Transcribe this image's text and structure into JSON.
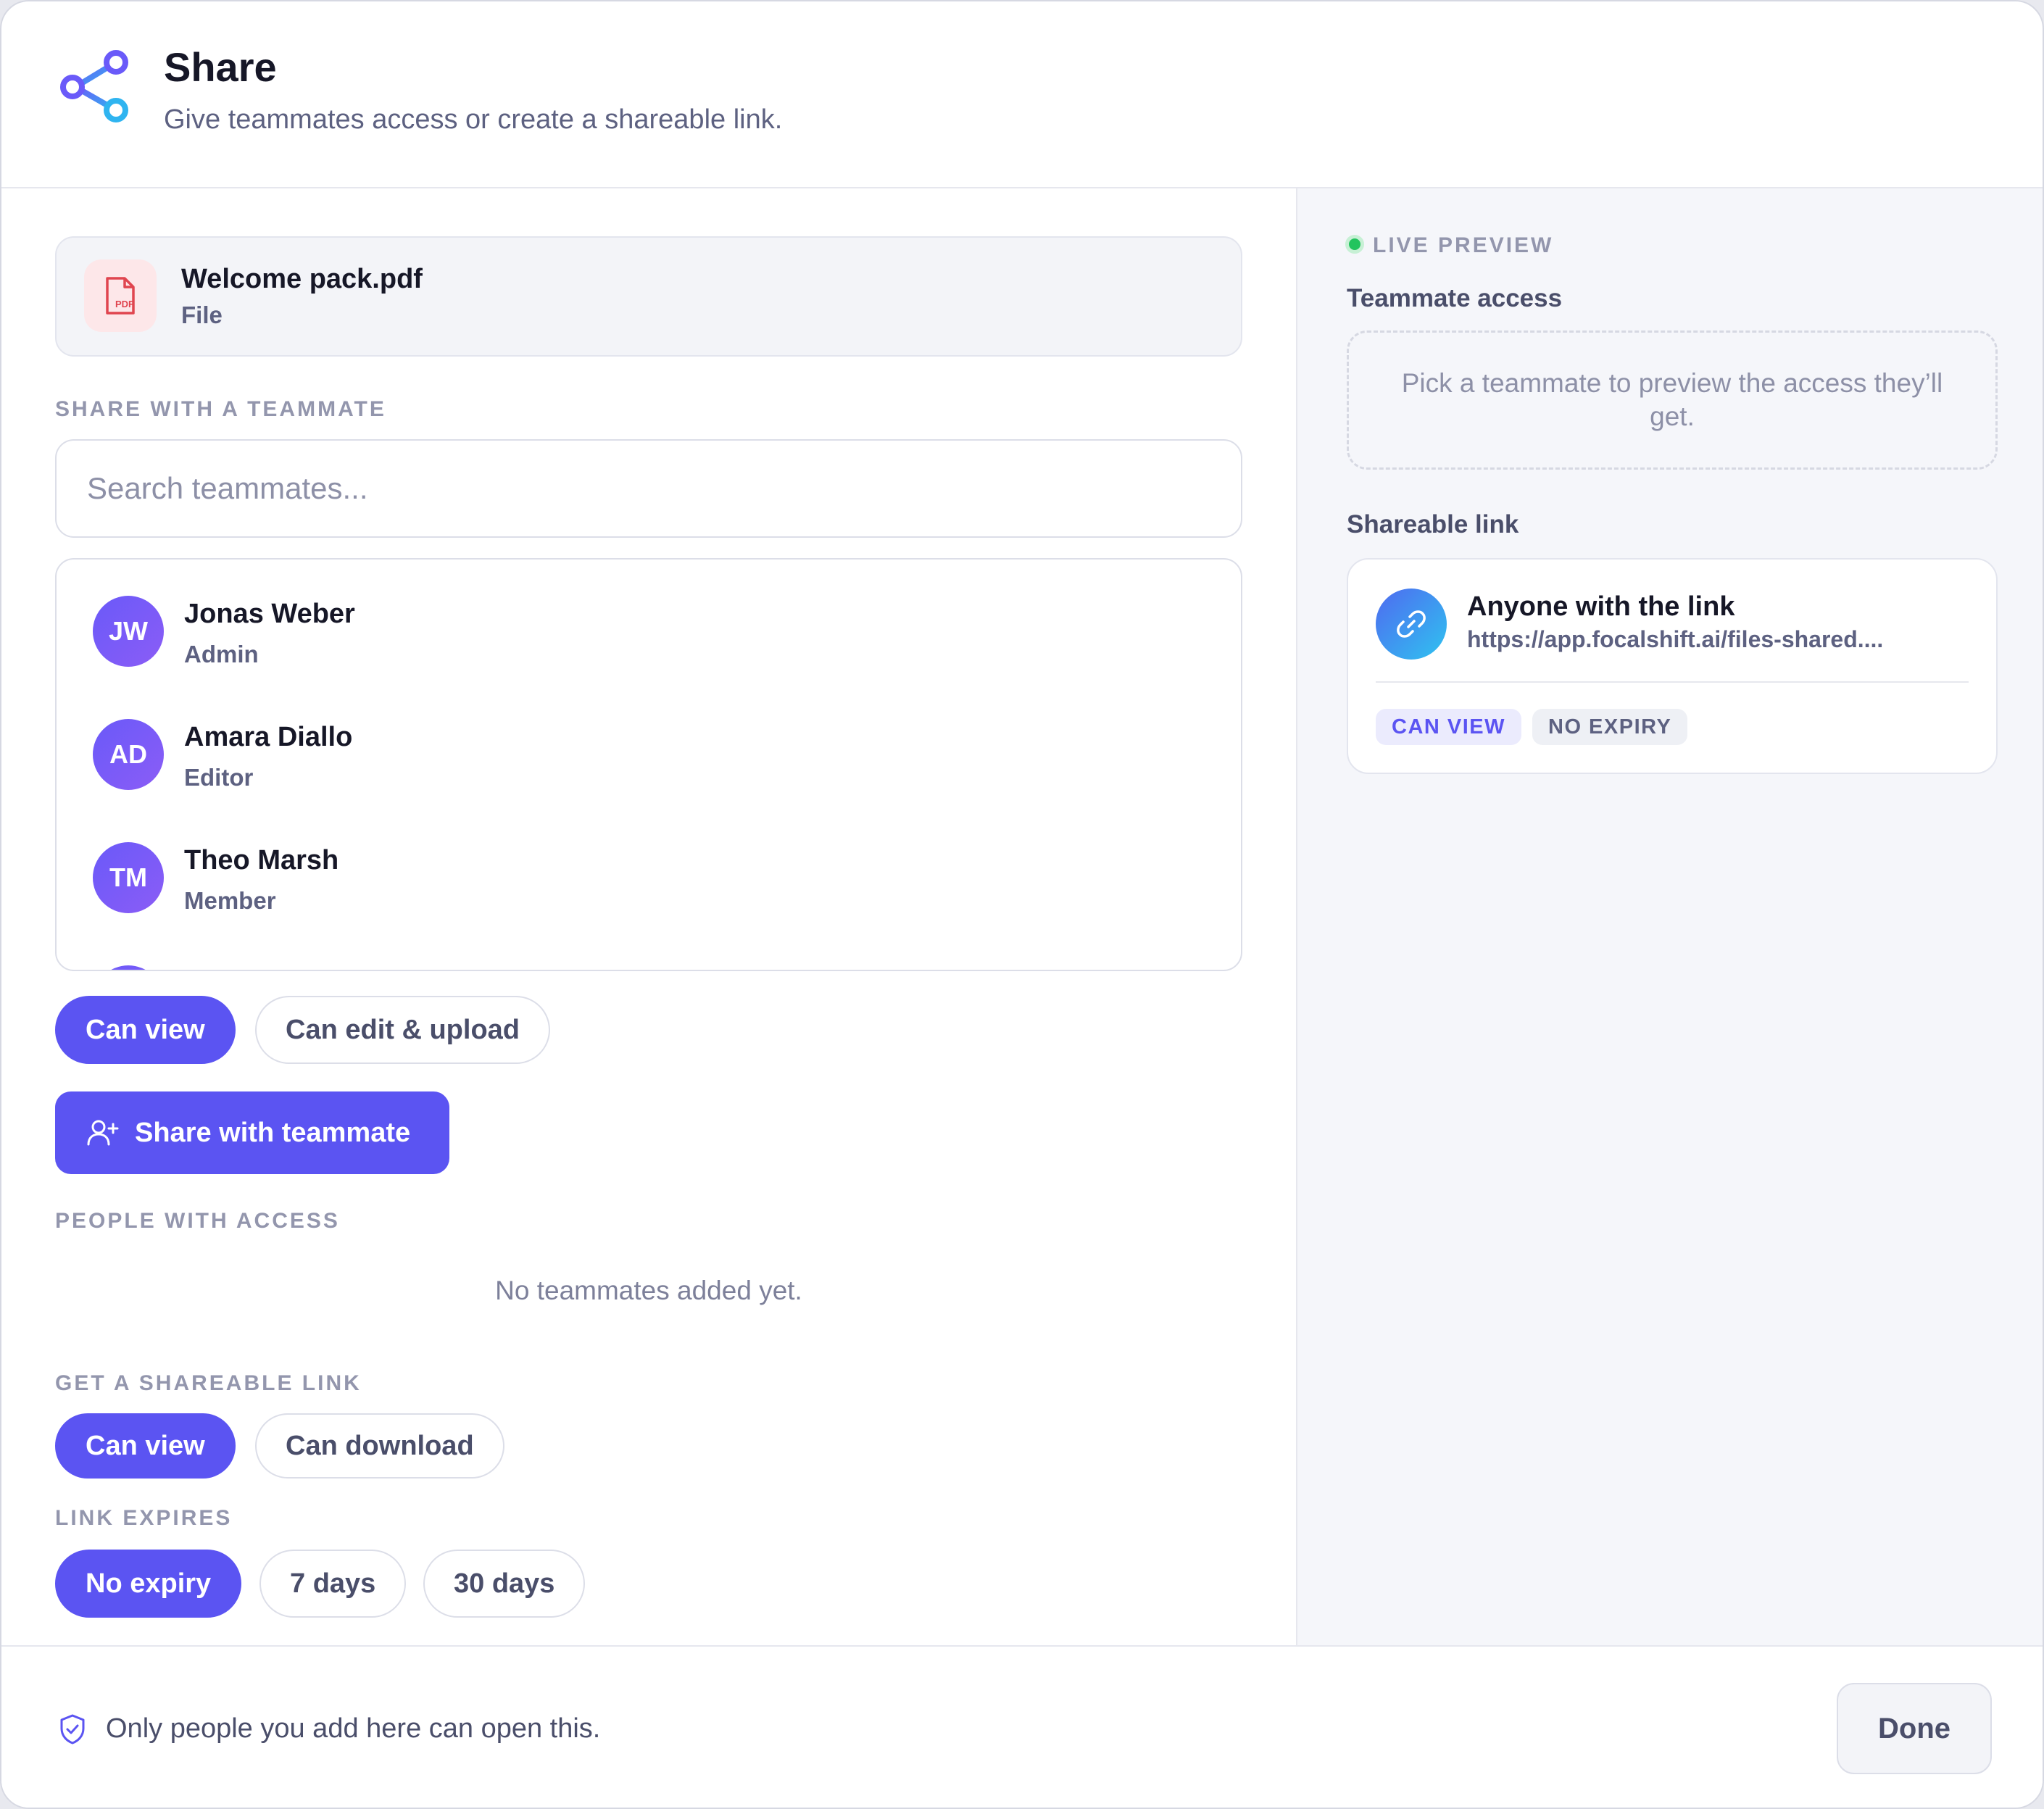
{
  "header": {
    "title": "Share",
    "subtitle": "Give teammates access or create a shareable link.",
    "icon": "share-icon"
  },
  "file": {
    "name": "Welcome pack.pdf",
    "type": "File",
    "icon_label": "PDF"
  },
  "teammate_section": {
    "label": "SHARE WITH A TEAMMATE",
    "search_placeholder": "Search teammates...",
    "members": [
      {
        "initials": "JW",
        "name": "Jonas Weber",
        "role": "Admin"
      },
      {
        "initials": "AD",
        "name": "Amara Diallo",
        "role": "Editor"
      },
      {
        "initials": "TM",
        "name": "Theo Marsh",
        "role": "Member"
      }
    ],
    "permissions": [
      "Can view",
      "Can edit & upload"
    ],
    "selected_permission": "Can view",
    "share_button": "Share with teammate"
  },
  "access_section": {
    "label": "PEOPLE WITH ACCESS",
    "empty_text": "No teammates added yet."
  },
  "link_section": {
    "label": "GET A SHAREABLE LINK",
    "permissions": [
      "Can view",
      "Can download"
    ],
    "selected_permission": "Can view",
    "expires_label": "LINK EXPIRES",
    "expiry_options": [
      "No expiry",
      "7 days",
      "30 days"
    ],
    "selected_expiry": "No expiry"
  },
  "preview": {
    "label": "LIVE PREVIEW",
    "teammate_heading": "Teammate access",
    "teammate_placeholder": "Pick a teammate to preview the access they’ll get.",
    "link_heading": "Shareable link",
    "link_title": "Anyone with the link",
    "link_url": "https://app.focalshift.ai/files-shared....",
    "tag_permission": "CAN VIEW",
    "tag_expiry": "NO EXPIRY"
  },
  "footer": {
    "note": "Only people you add here can open this.",
    "done_label": "Done"
  },
  "colors": {
    "accent": "#5b54f2",
    "live_dot": "#23c45e",
    "pdf_red": "#e0454f"
  }
}
